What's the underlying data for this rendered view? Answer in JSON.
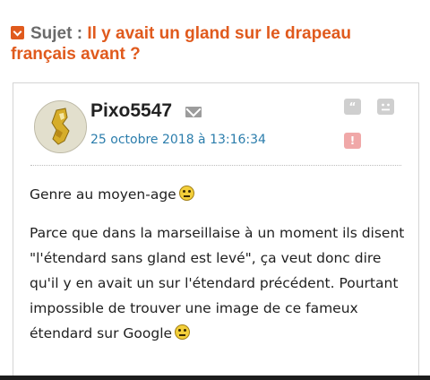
{
  "topic": {
    "prefix": "Sujet :",
    "title": "Il y avait un gland sur le drapeau français avant ?"
  },
  "post": {
    "username": "Pixo5547",
    "date": "25 octobre 2018 à 13:16:34",
    "buttons": {
      "quote_glyph": "“",
      "alert_glyph": "!"
    },
    "paragraph_1": "Genre au moyen-age",
    "paragraph_2": "Parce que dans la marseillaise à un moment ils disent \"l'étendard sans gland est levé\", ça veut donc dire qu'il y en avait un sur l'étendard précédent. Pourtant impossible de trouver une image de ce fameux étendard sur Google"
  },
  "colors": {
    "accent": "#e05a1d",
    "link": "#2b7dac",
    "text": "#1f1f1f"
  },
  "icons": [
    "chevron-down-icon",
    "message-icon",
    "quote-icon",
    "smiley-icon",
    "alert-icon",
    "emoji-icon"
  ]
}
